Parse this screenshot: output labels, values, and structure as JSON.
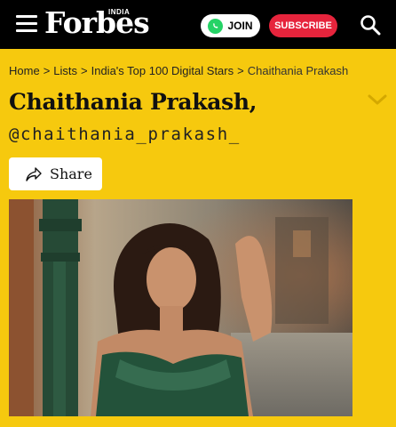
{
  "header": {
    "logo_text": "Forbes",
    "logo_edition": "INDIA",
    "join_label": "JOIN",
    "subscribe_label": "SUBSCRIBE"
  },
  "breadcrumb": {
    "items": [
      "Home",
      "Lists",
      "India's Top 100 Digital Stars",
      "Chaithania Prakash"
    ],
    "separator": ">"
  },
  "profile": {
    "name": "Chaithania Prakash,",
    "handle": "@chaithania_prakash_"
  },
  "share": {
    "label": "Share"
  },
  "colors": {
    "background": "#f6c90e",
    "topbar": "#000000",
    "subscribe": "#e6243c",
    "whatsapp": "#25d366"
  },
  "icons": [
    "menu-icon",
    "whatsapp-icon",
    "search-icon",
    "chevron-down-icon",
    "share-icon"
  ]
}
